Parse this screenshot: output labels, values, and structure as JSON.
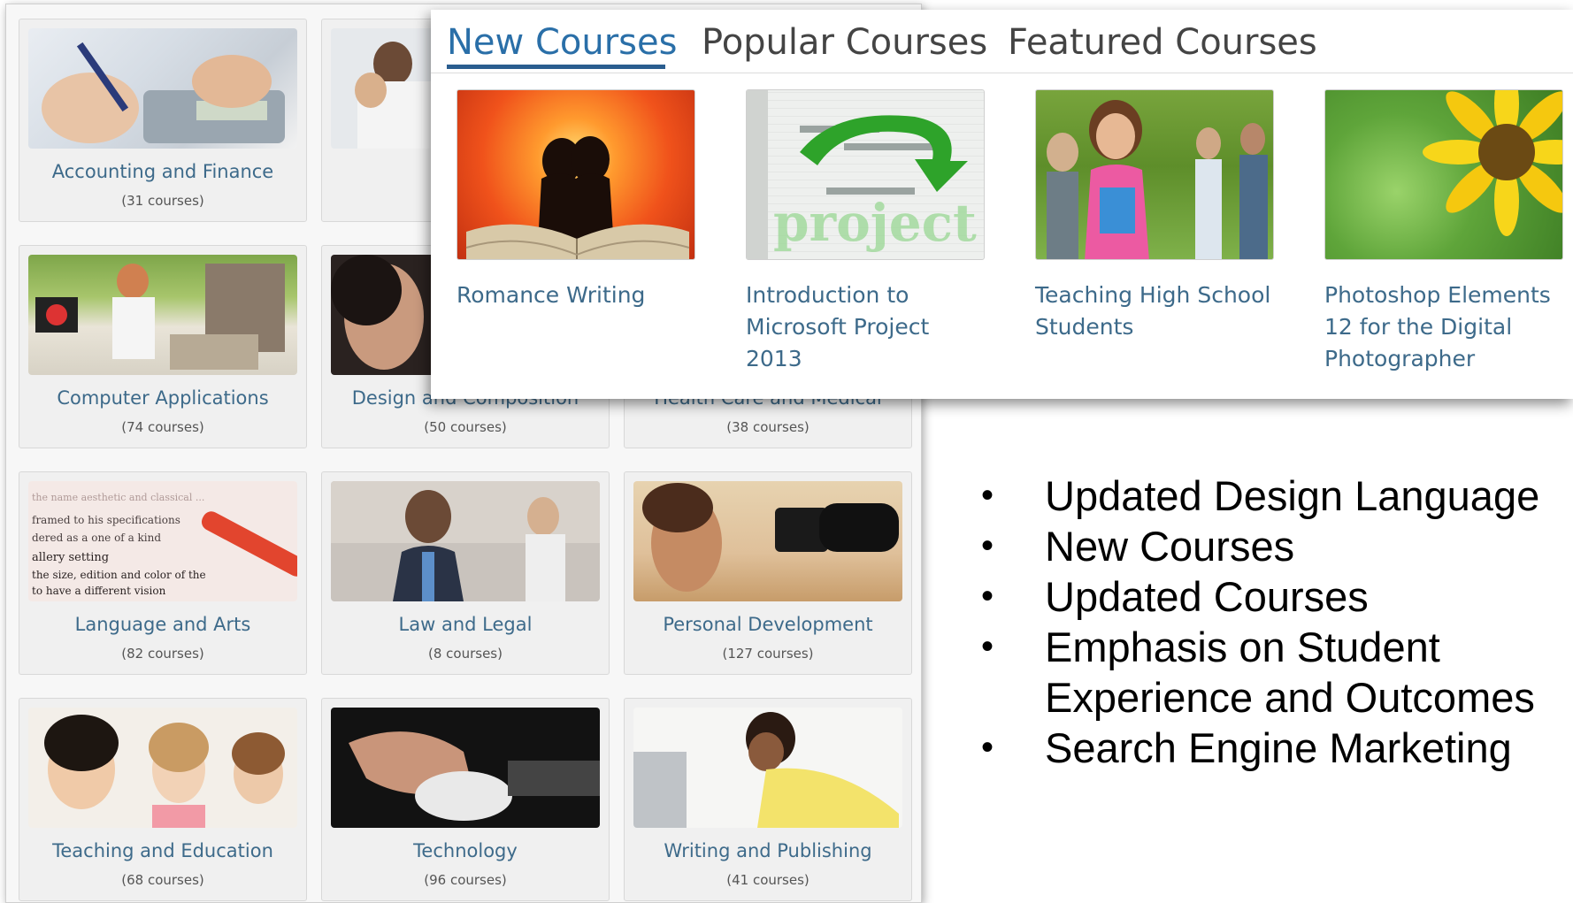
{
  "categories": [
    {
      "name": "Accounting and Finance",
      "count": "(31 courses)"
    },
    {
      "name": "",
      "count": ""
    },
    {
      "name": "",
      "count": ""
    },
    {
      "name": "Computer Applications",
      "count": "(74 courses)"
    },
    {
      "name": "Design and Composition",
      "count": "(50 courses)"
    },
    {
      "name": "Health Care and Medical",
      "count": "(38 courses)"
    },
    {
      "name": "Language and Arts",
      "count": "(82 courses)"
    },
    {
      "name": "Law and Legal",
      "count": "(8 courses)"
    },
    {
      "name": "Personal Development",
      "count": "(127 courses)"
    },
    {
      "name": "Teaching and Education",
      "count": "(68 courses)"
    },
    {
      "name": "Technology",
      "count": "(96 courses)"
    },
    {
      "name": "Writing and Publishing",
      "count": "(41 courses)"
    }
  ],
  "tabs": [
    {
      "label": "New Courses"
    },
    {
      "label": "Popular Courses"
    },
    {
      "label": "Featured Courses"
    }
  ],
  "courses": [
    {
      "title": "Romance Writing"
    },
    {
      "title": "Introduction to Microsoft Project 2013",
      "image_text": "project"
    },
    {
      "title": "Teaching High School Students"
    },
    {
      "title": "Photoshop Elements 12 for the Digital Photographer"
    }
  ],
  "bullets": [
    "Updated Design Language",
    "New Courses",
    "Updated Courses",
    "Emphasis on Student Experience and Outcomes",
    "Search Engine Marketing"
  ],
  "colors": {
    "link_blue": "#3d6a8a",
    "tab_active": "#2a6fa8",
    "tab_underline": "#2a5d8f"
  }
}
